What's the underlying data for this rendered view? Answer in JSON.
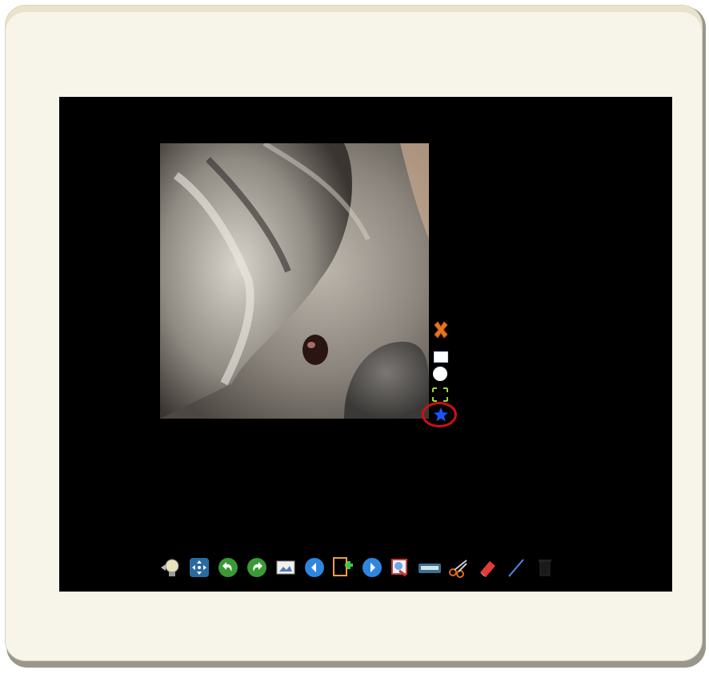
{
  "app": {
    "title": ""
  },
  "canvas": {
    "background": "#000000",
    "image": {
      "subject": "koala photo"
    }
  },
  "shape_tools": [
    {
      "name": "close-icon"
    },
    {
      "name": "rectangle-icon"
    },
    {
      "name": "circle-icon"
    },
    {
      "name": "expand-icon"
    },
    {
      "name": "star-icon",
      "highlighted": true
    }
  ],
  "toolbar": {
    "icons": [
      "lightbulb-icon",
      "move-arrows-icon",
      "undo-icon",
      "redo-icon",
      "photo-icon",
      "previous-icon",
      "add-page-icon",
      "next-icon",
      "presentation-icon",
      "keyboard-icon",
      "scissors-icon",
      "eraser-icon",
      "pen-icon",
      "trash-icon"
    ]
  },
  "colors": {
    "frame": "#f7f4ea",
    "highlight": "#d01010",
    "close": "#e8771e",
    "star": "#1a55ff",
    "expand": "#9ad63a"
  }
}
